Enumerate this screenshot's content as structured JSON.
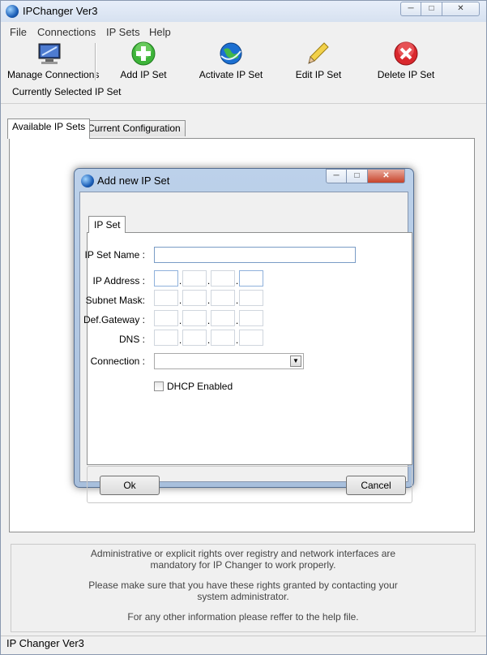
{
  "window": {
    "title": "IPChanger Ver3"
  },
  "menu": [
    "File",
    "Connections",
    "IP Sets",
    "Help"
  ],
  "toolbar": {
    "manage": "Manage Connections",
    "add": "Add IP Set",
    "activate": "Activate IP Set",
    "edit": "Edit IP Set",
    "delete": "Delete IP Set"
  },
  "current_label": "Currently Selected IP Set",
  "tabs": {
    "available": "Available IP Sets",
    "current": "Current Configuration"
  },
  "dialog": {
    "title": "Add new IP Set",
    "tab": "IP Set",
    "labels": {
      "name": "IP Set Name :",
      "ip": "IP Address :",
      "subnet": "Subnet Mask:",
      "gateway": "Def.Gateway :",
      "dns": "DNS :",
      "connection": "Connection :"
    },
    "name_value": "",
    "connection_value": "",
    "dhcp_label": "DHCP Enabled",
    "dhcp_checked": false,
    "ok": "Ok",
    "cancel": "Cancel"
  },
  "info": {
    "line1": "Administrative or explicit rights over registry and network interfaces are",
    "line2": "mandatory for IP Changer to work properly.",
    "line3": "Please make sure that you have these rights granted by contacting your",
    "line4": "system administrator.",
    "line5": "For any other information please reffer to the help file."
  },
  "status": "IP Changer Ver3",
  "colors": {
    "title_bar": "#dae5f3",
    "dialog_frame": "#b2c8e4",
    "close_red": "#c7432a"
  }
}
